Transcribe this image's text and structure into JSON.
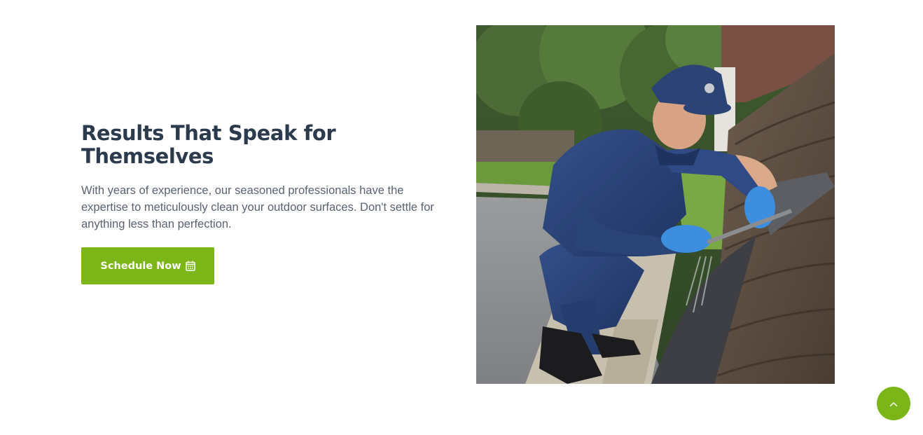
{
  "hero": {
    "heading": "Results That Speak for Themselves",
    "body": "With years of experience, our seasoned professionals have the expertise to meticulously clean your outdoor surfaces. Don't settle for anything less than perfection.",
    "cta": {
      "label": "Schedule Now",
      "icon": "calendar-icon"
    }
  },
  "photo": {
    "subject": "worker-cleaning-roof-gutter-photo"
  },
  "scroll_top": {
    "icon": "chevron-up-icon"
  },
  "colors": {
    "accent": "#7cb518",
    "heading": "#2b3a4d",
    "text": "#5a6270",
    "background": "#ffffff"
  }
}
